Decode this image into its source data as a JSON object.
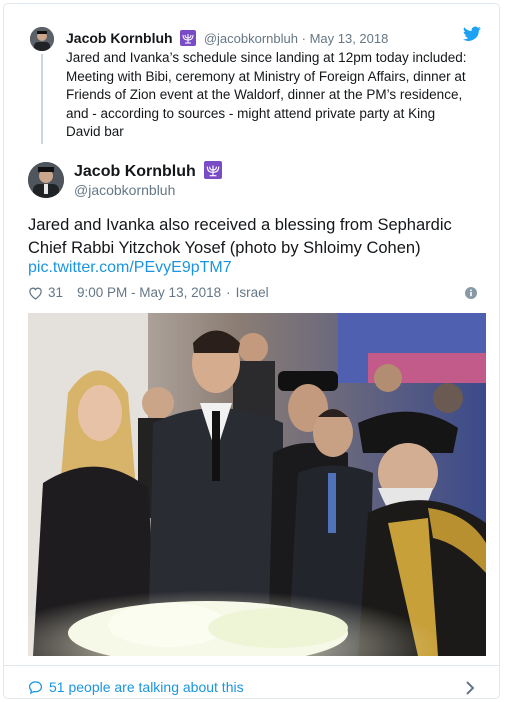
{
  "quoted_tweet": {
    "author_name": "Jacob Kornbluh",
    "handle": "@jacobkornbluh",
    "separator": "·",
    "date": "May 13, 2018",
    "text": "Jared and Ivanka’s schedule since landing at 12pm today included: Meeting with Bibi, ceremony at Ministry of Foreign Affairs, dinner at Friends of Zion event at the Waldorf, dinner at the PM’s residence, and - according to sources - might attend private party at King David bar"
  },
  "main_tweet": {
    "author_name": "Jacob Kornbluh",
    "handle": "@jacobkornbluh",
    "text": "Jared and Ivanka also received a blessing from Sephardic Chief Rabbi Yitzchok Yosef (photo by Shloimy Cohen)",
    "link": "pic.twitter.com/PEvyE9pTM7",
    "likes": "31",
    "timestamp": "9:00 PM - May 13, 2018",
    "location_separator": "·",
    "location": "Israel"
  },
  "footer": {
    "conversation_text": "51 people are talking about this"
  },
  "icons": {
    "brand": "twitter-bird-icon",
    "like": "heart-icon",
    "info": "info-icon",
    "reply": "speech-bubble-icon",
    "more": "chevron-right-icon",
    "badge": "menorah-icon"
  },
  "colors": {
    "link": "#1b95e0",
    "muted": "#657786",
    "twitter_blue": "#1da1f2",
    "badge": "#794bc4"
  }
}
